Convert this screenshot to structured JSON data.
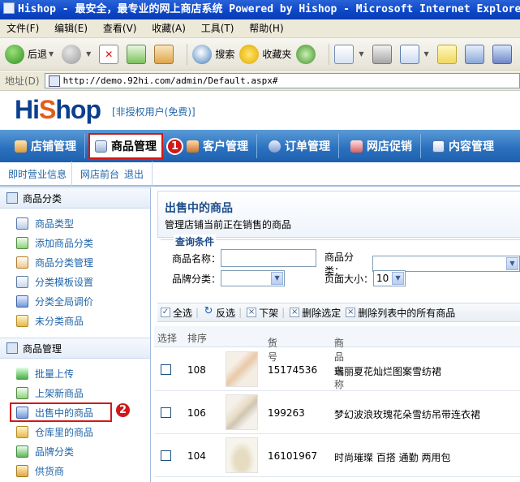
{
  "window": {
    "title": "Hishop - 最安全，最专业的网上商店系统 Powered by Hishop - Microsoft Internet Explorer"
  },
  "menubar": [
    "文件(F)",
    "编辑(E)",
    "查看(V)",
    "收藏(A)",
    "工具(T)",
    "帮助(H)"
  ],
  "toolbar": {
    "back": "后退",
    "search": "搜索",
    "favorites": "收藏夹"
  },
  "address": {
    "label": "地址(D)",
    "url": "http://demo.92hi.com/admin/Default.aspx#"
  },
  "header": {
    "logo_main": "Hi",
    "logo_mid": "S",
    "logo_end": "hop",
    "unauthorized": "[非授权用户(免费)]"
  },
  "topnav": [
    {
      "label": "店铺管理"
    },
    {
      "label": "商品管理",
      "active": true
    },
    {
      "label": "客户管理"
    },
    {
      "label": "订单管理"
    },
    {
      "label": "网店促销"
    },
    {
      "label": "内容管理"
    }
  ],
  "callouts": {
    "one": "1",
    "two": "2"
  },
  "subnav": [
    "即时营业信息",
    "网店前台",
    "退出"
  ],
  "sidebar": {
    "section1": {
      "title": "商品分类",
      "items": [
        "商品类型",
        "添加商品分类",
        "商品分类管理",
        "分类模板设置",
        "分类全局调价",
        "未分类商品"
      ]
    },
    "section2": {
      "title": "商品管理",
      "items": [
        "批量上传",
        "上架新商品",
        "出售中的商品",
        "仓库里的商品",
        "品牌分类",
        "供货商"
      ]
    }
  },
  "main": {
    "title": "出售中的商品",
    "description": "管理店铺当前正在销售的商品",
    "query": {
      "legend": "查询条件",
      "product_name_label": "商品名称：",
      "product_category_label": "商品分类：",
      "brand_category_label": "品牌分类：",
      "page_size_label": "页面大小：",
      "page_size_value": "10"
    },
    "actions": {
      "select_all": "全选",
      "invert": "反选",
      "unlist": "下架",
      "delete_selected": "删除选定",
      "delete_all": "删除列表中的所有商品"
    },
    "table": {
      "headers": {
        "select": "选择",
        "order": "排序",
        "sku": "货号",
        "name": "商品名称"
      },
      "rows": [
        {
          "order": "108",
          "sku": "15174536",
          "name": "瑞丽夏花灿烂图案雪纺裙"
        },
        {
          "order": "106",
          "sku": "199263",
          "name": "梦幻波浪玫瑰花朵雪纺吊带连衣裙"
        },
        {
          "order": "104",
          "sku": "16101967",
          "name": "时尚璀璨 百搭 通勤 两用包"
        }
      ]
    }
  },
  "colors": {
    "nav_blue": "#2c72c0",
    "highlight_red": "#d01818",
    "link_blue": "#2266aa"
  }
}
